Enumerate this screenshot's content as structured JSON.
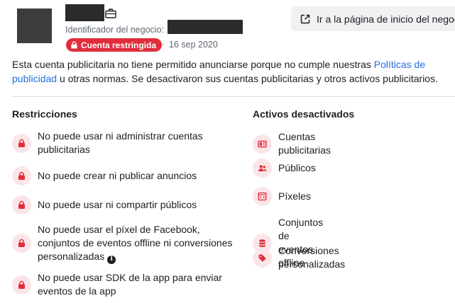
{
  "header": {
    "business_id_label": "Identificador del negocio:",
    "status_badge": "Cuenta restringida",
    "separator": "·",
    "date": "16 sep 2020",
    "home_button_label": "Ir a la página de inicio del negocio"
  },
  "description": {
    "part1": "Esta cuenta publicitaria no tiene permitido anunciarse porque no cumple nuestras ",
    "link": "Políticas de publicidad",
    "part2": " u otras normas. Se desactivaron sus cuentas publicitarias y otros activos publicitarios."
  },
  "restrictions": {
    "title": "Restricciones",
    "items": [
      "No puede usar ni administrar cuentas publicitarias",
      "No puede crear ni publicar anuncios",
      "No puede usar ni compartir públicos",
      "No puede usar el píxel de Facebook, conjuntos de eventos offline ni conversiones personalizadas",
      "No puede usar SDK de la app para enviar eventos de la app"
    ]
  },
  "disabled_assets": {
    "title": "Activos desactivados",
    "items": [
      {
        "label": "Cuentas publicitarias",
        "icon": "ad-account-icon"
      },
      {
        "label": "Públicos",
        "icon": "audience-icon"
      },
      {
        "label": "Píxeles",
        "icon": "pixel-code-icon"
      },
      {
        "label": "Conjuntos de eventos offline",
        "icon": "database-icon"
      },
      {
        "label": "Conversiones personalizadas",
        "icon": "tag-icon"
      }
    ]
  },
  "colors": {
    "accent_red": "#e02d3b",
    "link_blue": "#216fdb",
    "icon_bg": "#fbe5e8"
  }
}
